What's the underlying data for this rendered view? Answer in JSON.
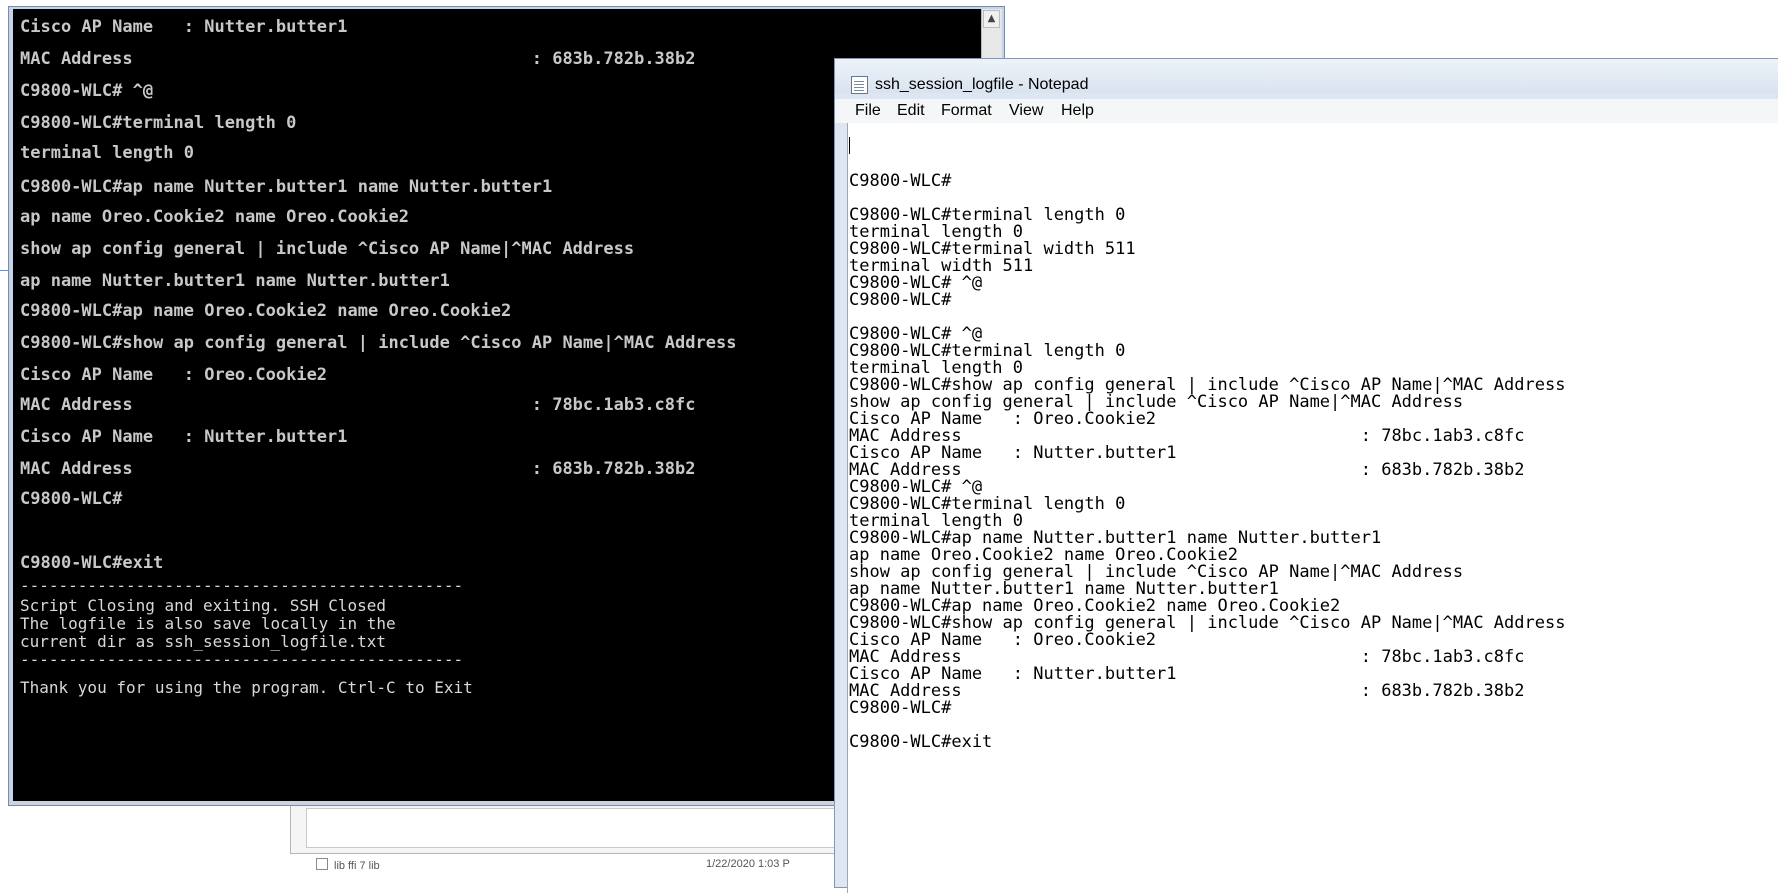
{
  "console": {
    "lines": [
      "Cisco AP Name   : Nutter.butter1",
      "MAC Address                                       : 683b.782b.38b2",
      "C9800-WLC# ^@",
      "C9800-WLC#terminal length 0",
      "terminal length 0",
      "C9800-WLC#ap name Nutter.butter1 name Nutter.butter1",
      "ap name Oreo.Cookie2 name Oreo.Cookie2",
      "show ap config general | include ^Cisco AP Name|^MAC Address",
      "ap name Nutter.butter1 name Nutter.butter1",
      "C9800-WLC#ap name Oreo.Cookie2 name Oreo.Cookie2",
      "C9800-WLC#show ap config general | include ^Cisco AP Name|^MAC Address",
      "Cisco AP Name   : Oreo.Cookie2",
      "MAC Address                                       : 78bc.1ab3.c8fc",
      "Cisco AP Name   : Nutter.butter1",
      "MAC Address                                       : 683b.782b.38b2",
      "C9800-WLC#",
      "C9800-WLC#exit",
      "----------------------------------------------",
      "Script Closing and exiting. SSH Closed",
      "The logfile is also save locally in the",
      "current dir as ssh_session_logfile.txt",
      "----------------------------------------------",
      "Thank you for using the program. Ctrl-C to Exit"
    ],
    "scroll_up_glyph": "▲"
  },
  "notepad": {
    "title": "ssh_session_logfile - Notepad",
    "menu": [
      "File",
      "Edit",
      "Format",
      "View",
      "Help"
    ],
    "lines": [
      "C9800-WLC#",
      "C9800-WLC#terminal length 0",
      "terminal length 0",
      "C9800-WLC#terminal width 511",
      "terminal width 511",
      "C9800-WLC# ^@",
      "C9800-WLC#",
      "C9800-WLC# ^@",
      "C9800-WLC#terminal length 0",
      "terminal length 0",
      "C9800-WLC#show ap config general | include ^Cisco AP Name|^MAC Address",
      "show ap config general | include ^Cisco AP Name|^MAC Address",
      "Cisco AP Name   : Oreo.Cookie2",
      "MAC Address                                       : 78bc.1ab3.c8fc",
      "Cisco AP Name   : Nutter.butter1",
      "MAC Address                                       : 683b.782b.38b2",
      "C9800-WLC# ^@",
      "C9800-WLC#terminal length 0",
      "terminal length 0",
      "C9800-WLC#ap name Nutter.butter1 name Nutter.butter1",
      "ap name Oreo.Cookie2 name Oreo.Cookie2",
      "show ap config general | include ^Cisco AP Name|^MAC Address",
      "ap name Nutter.butter1 name Nutter.butter1",
      "C9800-WLC#ap name Oreo.Cookie2 name Oreo.Cookie2",
      "C9800-WLC#show ap config general | include ^Cisco AP Name|^MAC Address",
      "Cisco AP Name   : Oreo.Cookie2",
      "MAC Address                                       : 78bc.1ab3.c8fc",
      "Cisco AP Name   : Nutter.butter1",
      "MAC Address                                       : 683b.782b.38b2",
      "C9800-WLC#",
      "C9800-WLC#exit"
    ]
  },
  "background": {
    "file_row_name": "lib ffi  7  lib",
    "file_row_date": "1/22/2020 1:03 P"
  }
}
